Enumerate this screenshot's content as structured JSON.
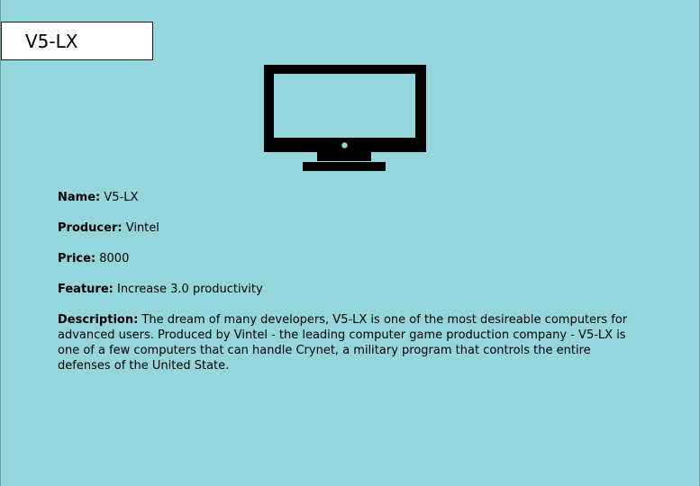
{
  "product": {
    "title": "V5-LX",
    "icon": "monitor-icon",
    "background_color": "#94d6dc",
    "fields": [
      {
        "key": "name",
        "label": "Name:",
        "value": "V5-LX"
      },
      {
        "key": "producer",
        "label": "Producer:",
        "value": "Vintel"
      },
      {
        "key": "price",
        "label": "Price:",
        "value": "8000"
      },
      {
        "key": "feature",
        "label": "Feature:",
        "value": "Increase 3.0 productivity"
      },
      {
        "key": "description",
        "label": "Description:",
        "value": "The dream of many developers, V5-LX is one of the most desireable computers for advanced users. Produced by Vintel - the leading computer game production company - V5-LX is one of a few computers that can handle Crynet, a military program that controls the entire defenses of the United State."
      }
    ]
  }
}
